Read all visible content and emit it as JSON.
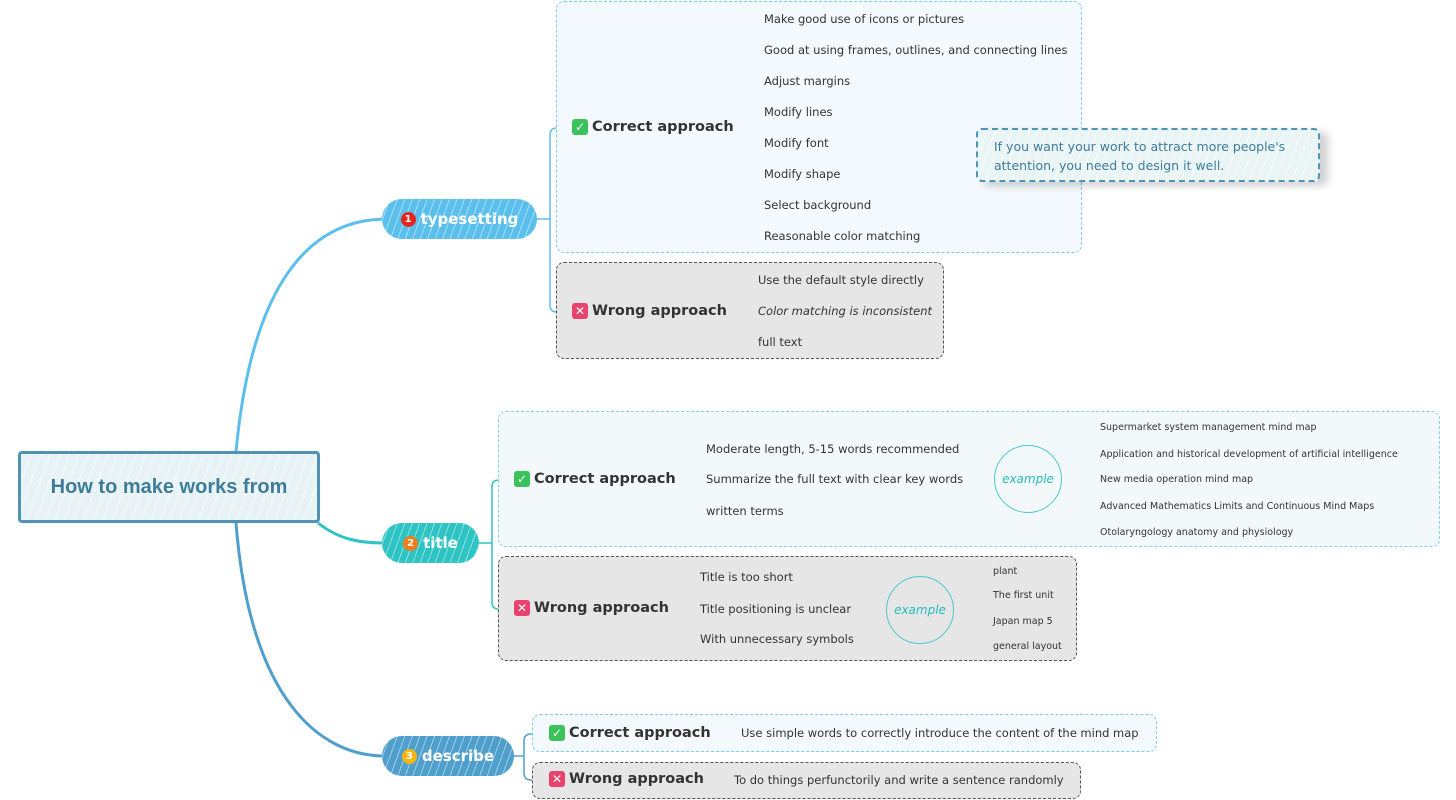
{
  "root": {
    "title": "How to make works from"
  },
  "colors": {
    "branch1": "#5bbfee",
    "branch2": "#2ec4c4",
    "branch3": "#4f9fcc",
    "correct_icon": "#3cc25a",
    "wrong_icon": "#e8436d",
    "note_text": "#3f7c9a"
  },
  "branches": [
    {
      "number": "1",
      "label": "typesetting",
      "correct": {
        "label": "Correct approach",
        "icon": "check-icon",
        "items": [
          "Make good use of icons or pictures",
          "Good at using frames, outlines, and connecting lines",
          "Adjust margins",
          "Modify lines",
          "Modify font",
          "Modify shape",
          "Select background",
          "Reasonable color matching"
        ]
      },
      "wrong": {
        "label": "Wrong approach",
        "icon": "cross-icon",
        "items": [
          "Use the default style directly",
          "Color matching is inconsistent",
          "full text"
        ]
      },
      "note": "If you want your work to attract more people's attention, you need to design it well."
    },
    {
      "number": "2",
      "label": "title",
      "correct": {
        "label": "Correct approach",
        "icon": "check-icon",
        "items": [
          "Moderate length, 5-15 words recommended",
          "Summarize the full text with clear key words",
          "written terms"
        ],
        "summary": "example",
        "examples": [
          "Supermarket system management mind map",
          "Application and historical development of artificial intelligence",
          "New media operation mind map",
          "Advanced Mathematics Limits and Continuous Mind Maps",
          "Otolaryngology anatomy and physiology"
        ]
      },
      "wrong": {
        "label": "Wrong approach",
        "icon": "cross-icon",
        "items": [
          "Title is too short",
          "Title positioning is unclear",
          "With unnecessary symbols"
        ],
        "summary": "example",
        "examples": [
          "plant",
          "The first unit",
          "Japan map 5",
          "general layout"
        ]
      }
    },
    {
      "number": "3",
      "label": "describe",
      "correct": {
        "label": "Correct approach",
        "icon": "check-icon",
        "items": [
          "Use simple words to correctly introduce the content of the mind map"
        ]
      },
      "wrong": {
        "label": "Wrong approach",
        "icon": "cross-icon",
        "items": [
          "To do things perfunctorily and write a sentence randomly"
        ]
      }
    }
  ]
}
